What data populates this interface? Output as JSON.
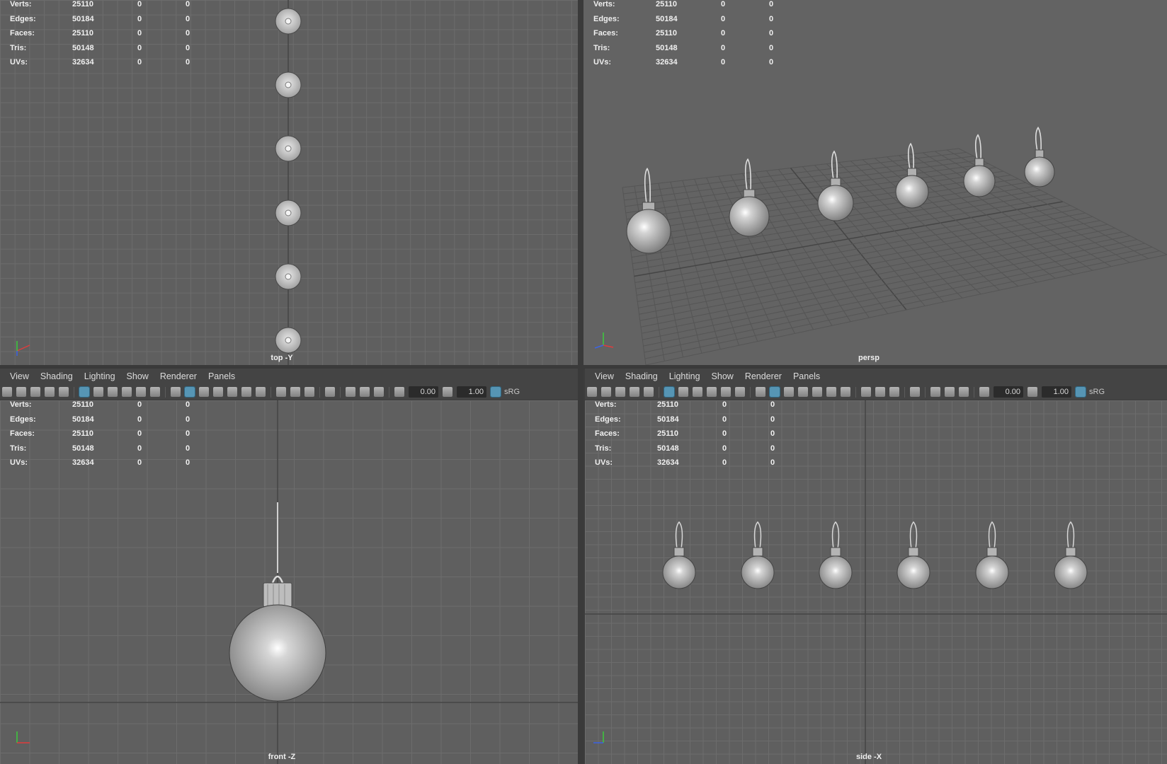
{
  "stats": {
    "rows": [
      {
        "label": "Verts:",
        "v1": "25110",
        "v2": "0",
        "v3": "0"
      },
      {
        "label": "Edges:",
        "v1": "50184",
        "v2": "0",
        "v3": "0"
      },
      {
        "label": "Faces:",
        "v1": "25110",
        "v2": "0",
        "v3": "0"
      },
      {
        "label": "Tris:",
        "v1": "50148",
        "v2": "0",
        "v3": "0"
      },
      {
        "label": "UVs:",
        "v1": "32634",
        "v2": "0",
        "v3": "0"
      }
    ]
  },
  "viewports": {
    "top": {
      "camera_label": "top -Y"
    },
    "persp": {
      "camera_label": "persp"
    },
    "front": {
      "camera_label": "front -Z"
    },
    "side": {
      "camera_label": "side -X"
    }
  },
  "panel_menu": [
    "View",
    "Shading",
    "Lighting",
    "Show",
    "Renderer",
    "Panels"
  ],
  "panel_toolbar": {
    "exposure": "0.00",
    "gamma": "1.00",
    "color_space": "sRG"
  },
  "colors": {
    "viewport_bg": "#5f5f5f",
    "grid_line": "#6c6c6c",
    "panel_bar": "#444444",
    "active_tool": "#5aa4c8",
    "axis_x": "#e03c3c",
    "axis_y": "#3ccc3c",
    "axis_z": "#3c64e6"
  },
  "icons": [
    "camera-icon",
    "camera-attributes-icon",
    "bookmark-icon",
    "image-plane-icon",
    "grid-icon",
    "film-gate-icon",
    "resolution-gate-icon",
    "gate-mask-icon",
    "field-chart-icon",
    "safe-action-icon",
    "safe-title-icon",
    "wireframe-icon",
    "smooth-shade-icon",
    "default-material-icon",
    "textured-icon",
    "lights-icon",
    "shadows-icon",
    "ambient-occlusion-icon",
    "motion-blur-icon",
    "anti-alias-icon",
    "depth-of-field-icon",
    "isolate-select-icon",
    "xray-icon",
    "xray-joints-icon",
    "xray-active-icon",
    "exposure-icon",
    "gamma-icon",
    "color-management-icon"
  ]
}
